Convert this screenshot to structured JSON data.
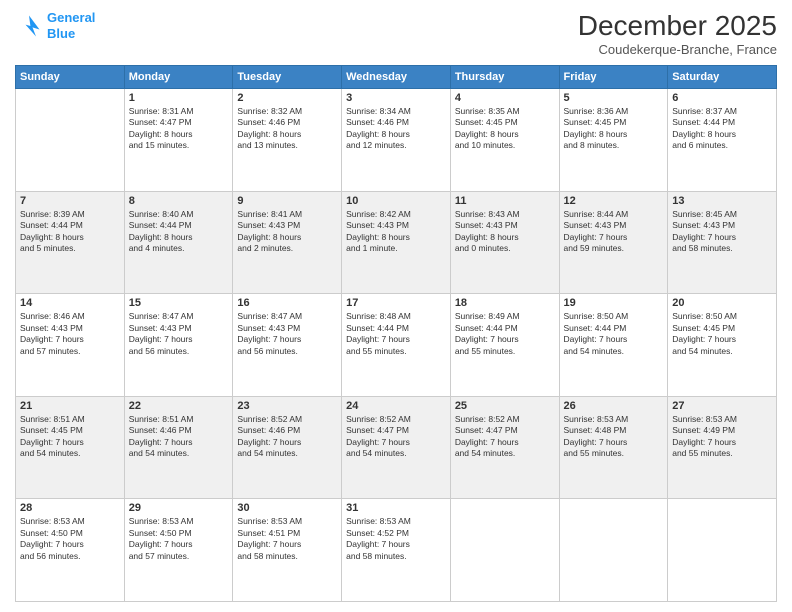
{
  "logo": {
    "line1": "General",
    "line2": "Blue"
  },
  "title": "December 2025",
  "subtitle": "Coudekerque-Branche, France",
  "days_of_week": [
    "Sunday",
    "Monday",
    "Tuesday",
    "Wednesday",
    "Thursday",
    "Friday",
    "Saturday"
  ],
  "weeks": [
    [
      {
        "day": "",
        "info": ""
      },
      {
        "day": "1",
        "info": "Sunrise: 8:31 AM\nSunset: 4:47 PM\nDaylight: 8 hours\nand 15 minutes."
      },
      {
        "day": "2",
        "info": "Sunrise: 8:32 AM\nSunset: 4:46 PM\nDaylight: 8 hours\nand 13 minutes."
      },
      {
        "day": "3",
        "info": "Sunrise: 8:34 AM\nSunset: 4:46 PM\nDaylight: 8 hours\nand 12 minutes."
      },
      {
        "day": "4",
        "info": "Sunrise: 8:35 AM\nSunset: 4:45 PM\nDaylight: 8 hours\nand 10 minutes."
      },
      {
        "day": "5",
        "info": "Sunrise: 8:36 AM\nSunset: 4:45 PM\nDaylight: 8 hours\nand 8 minutes."
      },
      {
        "day": "6",
        "info": "Sunrise: 8:37 AM\nSunset: 4:44 PM\nDaylight: 8 hours\nand 6 minutes."
      }
    ],
    [
      {
        "day": "7",
        "info": "Sunrise: 8:39 AM\nSunset: 4:44 PM\nDaylight: 8 hours\nand 5 minutes."
      },
      {
        "day": "8",
        "info": "Sunrise: 8:40 AM\nSunset: 4:44 PM\nDaylight: 8 hours\nand 4 minutes."
      },
      {
        "day": "9",
        "info": "Sunrise: 8:41 AM\nSunset: 4:43 PM\nDaylight: 8 hours\nand 2 minutes."
      },
      {
        "day": "10",
        "info": "Sunrise: 8:42 AM\nSunset: 4:43 PM\nDaylight: 8 hours\nand 1 minute."
      },
      {
        "day": "11",
        "info": "Sunrise: 8:43 AM\nSunset: 4:43 PM\nDaylight: 8 hours\nand 0 minutes."
      },
      {
        "day": "12",
        "info": "Sunrise: 8:44 AM\nSunset: 4:43 PM\nDaylight: 7 hours\nand 59 minutes."
      },
      {
        "day": "13",
        "info": "Sunrise: 8:45 AM\nSunset: 4:43 PM\nDaylight: 7 hours\nand 58 minutes."
      }
    ],
    [
      {
        "day": "14",
        "info": "Sunrise: 8:46 AM\nSunset: 4:43 PM\nDaylight: 7 hours\nand 57 minutes."
      },
      {
        "day": "15",
        "info": "Sunrise: 8:47 AM\nSunset: 4:43 PM\nDaylight: 7 hours\nand 56 minutes."
      },
      {
        "day": "16",
        "info": "Sunrise: 8:47 AM\nSunset: 4:43 PM\nDaylight: 7 hours\nand 56 minutes."
      },
      {
        "day": "17",
        "info": "Sunrise: 8:48 AM\nSunset: 4:44 PM\nDaylight: 7 hours\nand 55 minutes."
      },
      {
        "day": "18",
        "info": "Sunrise: 8:49 AM\nSunset: 4:44 PM\nDaylight: 7 hours\nand 55 minutes."
      },
      {
        "day": "19",
        "info": "Sunrise: 8:50 AM\nSunset: 4:44 PM\nDaylight: 7 hours\nand 54 minutes."
      },
      {
        "day": "20",
        "info": "Sunrise: 8:50 AM\nSunset: 4:45 PM\nDaylight: 7 hours\nand 54 minutes."
      }
    ],
    [
      {
        "day": "21",
        "info": "Sunrise: 8:51 AM\nSunset: 4:45 PM\nDaylight: 7 hours\nand 54 minutes."
      },
      {
        "day": "22",
        "info": "Sunrise: 8:51 AM\nSunset: 4:46 PM\nDaylight: 7 hours\nand 54 minutes."
      },
      {
        "day": "23",
        "info": "Sunrise: 8:52 AM\nSunset: 4:46 PM\nDaylight: 7 hours\nand 54 minutes."
      },
      {
        "day": "24",
        "info": "Sunrise: 8:52 AM\nSunset: 4:47 PM\nDaylight: 7 hours\nand 54 minutes."
      },
      {
        "day": "25",
        "info": "Sunrise: 8:52 AM\nSunset: 4:47 PM\nDaylight: 7 hours\nand 54 minutes."
      },
      {
        "day": "26",
        "info": "Sunrise: 8:53 AM\nSunset: 4:48 PM\nDaylight: 7 hours\nand 55 minutes."
      },
      {
        "day": "27",
        "info": "Sunrise: 8:53 AM\nSunset: 4:49 PM\nDaylight: 7 hours\nand 55 minutes."
      }
    ],
    [
      {
        "day": "28",
        "info": "Sunrise: 8:53 AM\nSunset: 4:50 PM\nDaylight: 7 hours\nand 56 minutes."
      },
      {
        "day": "29",
        "info": "Sunrise: 8:53 AM\nSunset: 4:50 PM\nDaylight: 7 hours\nand 57 minutes."
      },
      {
        "day": "30",
        "info": "Sunrise: 8:53 AM\nSunset: 4:51 PM\nDaylight: 7 hours\nand 58 minutes."
      },
      {
        "day": "31",
        "info": "Sunrise: 8:53 AM\nSunset: 4:52 PM\nDaylight: 7 hours\nand 58 minutes."
      },
      {
        "day": "",
        "info": ""
      },
      {
        "day": "",
        "info": ""
      },
      {
        "day": "",
        "info": ""
      }
    ]
  ]
}
